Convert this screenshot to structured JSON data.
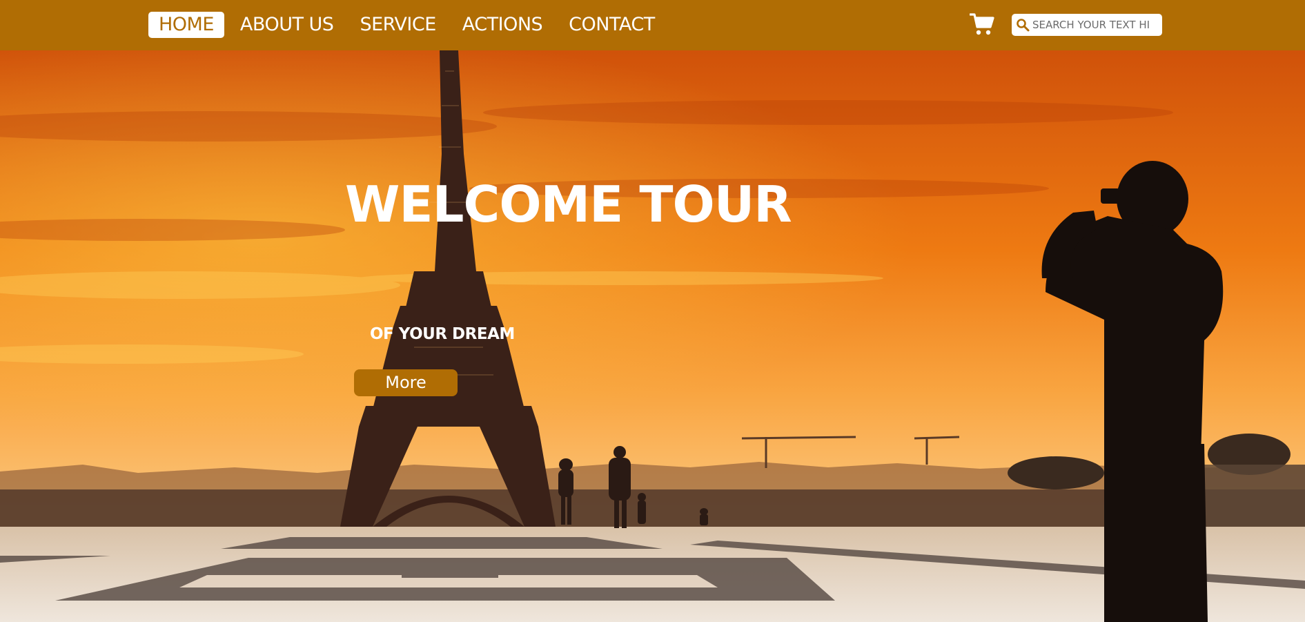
{
  "nav": {
    "items": [
      {
        "label": "HOME",
        "active": true
      },
      {
        "label": "ABOUT US",
        "active": false
      },
      {
        "label": "SERVICE",
        "active": false
      },
      {
        "label": "ACTIONS",
        "active": false
      },
      {
        "label": "CONTACT",
        "active": false
      }
    ]
  },
  "header": {
    "cart_icon": "shopping-cart-icon",
    "search": {
      "icon": "search-icon",
      "placeholder": "SEARCH YOUR TEXT HI",
      "value": ""
    }
  },
  "hero": {
    "title": "WELCOME TOUR",
    "subtitle": "OF YOUR DREAM",
    "button_label": "More"
  },
  "colors": {
    "accent": "#b06d04",
    "text_light": "#ffffff"
  }
}
